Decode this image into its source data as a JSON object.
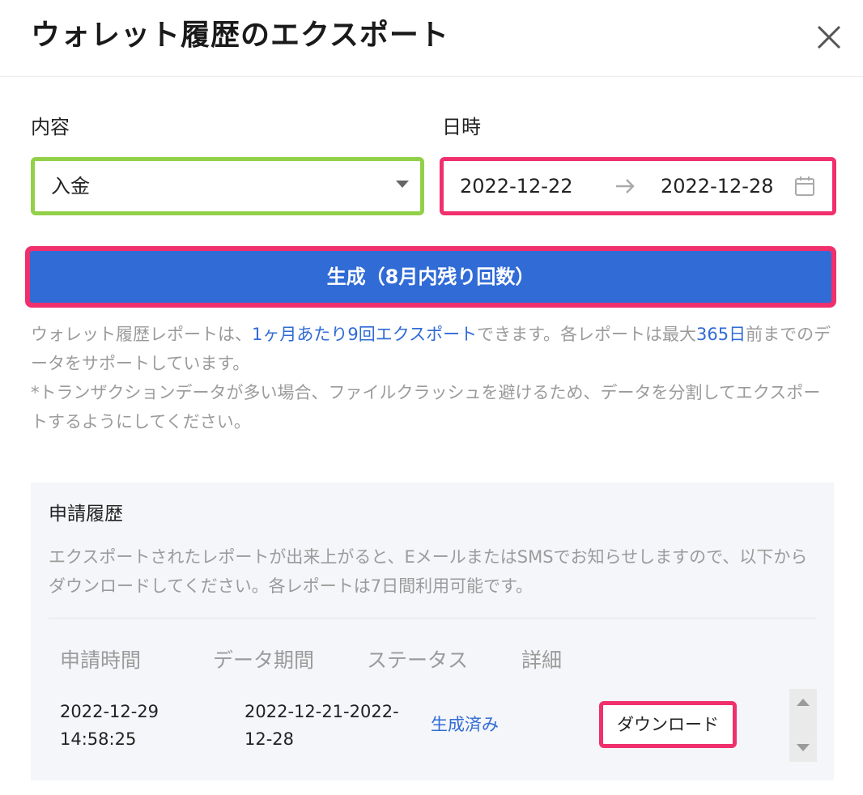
{
  "dialog": {
    "title": "ウォレット履歴のエクスポート",
    "close_icon": "close-icon"
  },
  "form": {
    "content_label": "内容",
    "content_value": "入金",
    "date_label": "日時",
    "date_start": "2022-12-22",
    "date_end": "2022-12-28",
    "generate_label": "生成（8月内残り回数）"
  },
  "info": {
    "p1_a": "ウォレット履歴レポートは、",
    "p1_b": "1ヶ月あたり9回エクスポート",
    "p1_c": "できます。各レポートは最大",
    "p1_d": "365日",
    "p1_e": "前までのデータをサポートしています。",
    "p2": "*トランザクションデータが多い場合、ファイルクラッシュを避けるため、データを分割してエクスポートするようにしてください。"
  },
  "history": {
    "title": "申請履歴",
    "description": "エクスポートされたレポートが出来上がると、EメールまたはSMSでお知らせしますので、以下からダウンロードしてください。各レポートは7日間利用可能です。",
    "columns": [
      "申請時間",
      "データ期間",
      "ステータス",
      "詳細"
    ],
    "rows": [
      {
        "request_date": "2022-12-29",
        "request_time": "14:58:25",
        "period_line1": "2022-12-21-2022-",
        "period_line2": "12-28",
        "status": "生成済み",
        "action": "ダウンロード"
      }
    ]
  },
  "colors": {
    "primary": "#306bd6",
    "highlight_red": "#f0306d",
    "highlight_green": "#93d049",
    "muted_text": "#9b9b9b"
  }
}
